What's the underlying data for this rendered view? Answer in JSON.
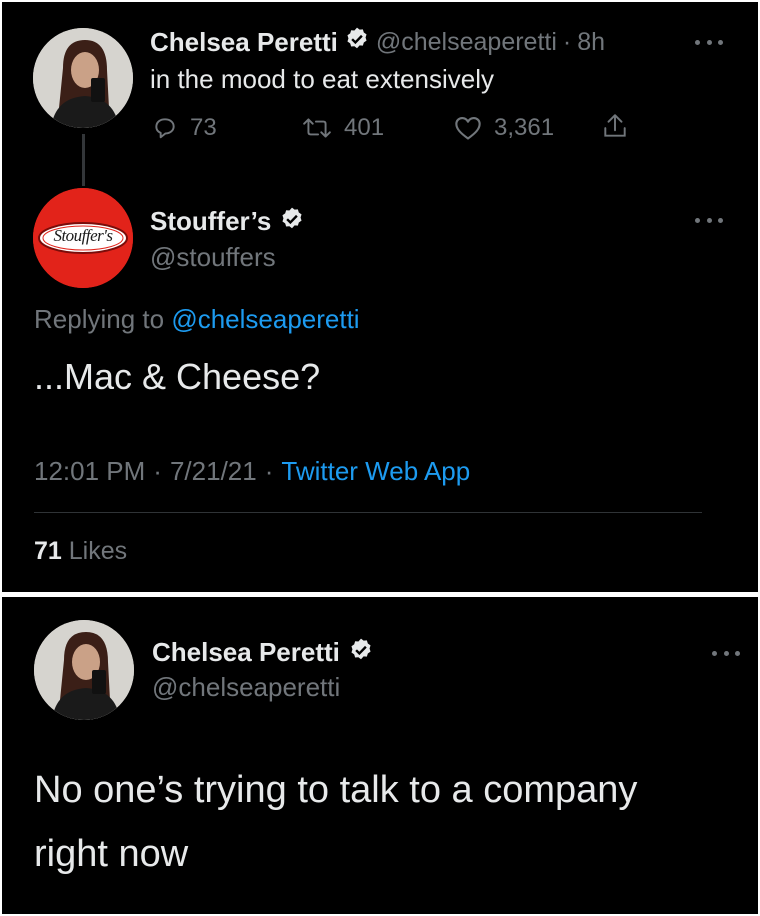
{
  "tweet1": {
    "author_name": "Chelsea Peretti",
    "handle": "@chelseaperetti",
    "separator": "·",
    "time": "8h",
    "text": "in the mood to eat extensively",
    "actions": {
      "replies": "73",
      "retweets": "401",
      "likes": "3,361"
    },
    "icons": [
      "reply-icon",
      "retweet-icon",
      "heart-icon",
      "share-icon",
      "more-icon",
      "verified-icon"
    ]
  },
  "reply": {
    "author_name": "Stouffer’s",
    "handle": "@stouffers",
    "logo_text": "Stouffer's",
    "replying_prefix": "Replying to",
    "replying_handle": "@chelseaperetti",
    "text": "...Mac & Cheese?",
    "time": "12:01 PM",
    "dot1": "·",
    "date": "7/21/21",
    "dot2": "·",
    "source": "Twitter Web App",
    "likes_count": "71",
    "likes_label": "Likes"
  },
  "tweet2": {
    "author_name": "Chelsea Peretti",
    "handle": "@chelseaperetti",
    "text_line1": "No one’s trying to talk to a company",
    "text_line2": "right now"
  },
  "colors": {
    "background": "#000000",
    "text": "#e7e9ea",
    "muted": "#71767b",
    "link": "#1d9bf0",
    "verified_badge": "#e7e9ea",
    "stouffers_red": "#e2231a"
  }
}
